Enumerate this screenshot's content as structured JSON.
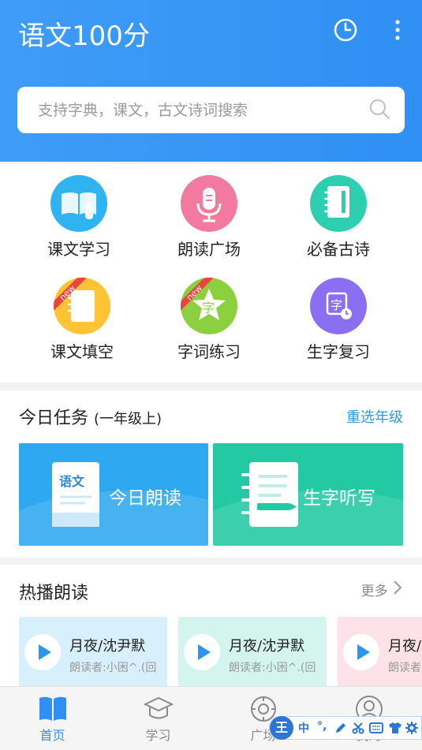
{
  "header": {
    "title": "语文100分",
    "icons": [
      "clock-icon",
      "more-vertical-icon"
    ]
  },
  "search": {
    "placeholder": "支持字典，课文，古文诗词搜索"
  },
  "features": [
    {
      "label": "课文学习",
      "color": "#2fb3f1",
      "icon": "book-hand-icon"
    },
    {
      "label": "朗读广场",
      "color": "#f27aa0",
      "icon": "microphone-icon"
    },
    {
      "label": "必备古诗",
      "color": "#2dcfb0",
      "icon": "notebook-icon"
    },
    {
      "label": "课文填空",
      "color": "#ffc333",
      "icon": "document-icon",
      "badge": "new"
    },
    {
      "label": "字词练习",
      "color": "#8ccf3f",
      "icon": "star-character-icon",
      "badge": "new",
      "glyph": "字"
    },
    {
      "label": "生字复习",
      "color": "#8b6ff2",
      "icon": "character-clock-icon",
      "glyph": "字"
    }
  ],
  "tasks": {
    "title": "今日任务",
    "grade": "(一年级上)",
    "reselect": "重选年级",
    "items": [
      {
        "label": "今日朗读",
        "book_text": "语文",
        "color": "#2ea8f0"
      },
      {
        "label": "生字听写",
        "color": "#22c9a3"
      }
    ]
  },
  "hot": {
    "title": "热播朗读",
    "more": "更多",
    "items": [
      {
        "name": "月夜/沈尹默",
        "reader": "朗读者:小困^.(回",
        "bg": "#d7f0fc"
      },
      {
        "name": "月夜/沈尹默",
        "reader": "朗读者:小困^.(回",
        "bg": "#d3f5ee"
      },
      {
        "name": "月夜/沈尹默",
        "reader": "朗读者:小困^.(回",
        "bg": "#fde2ea"
      }
    ]
  },
  "tabs": [
    {
      "label": "首页",
      "icon": "book-icon",
      "active": true
    },
    {
      "label": "学习",
      "icon": "graduation-cap-icon"
    },
    {
      "label": "广场",
      "icon": "compass-icon"
    },
    {
      "label": "我的",
      "icon": "user-icon"
    }
  ],
  "ime_toolbar": {
    "logo": "王",
    "mode": "中",
    "icons": [
      "punctuation-icon",
      "pen-icon",
      "scissors-icon",
      "keyboard-icon",
      "shirt-icon",
      "settings-icon"
    ]
  },
  "colors": {
    "primary": "#2f8ff3",
    "link": "#2f9bde"
  }
}
